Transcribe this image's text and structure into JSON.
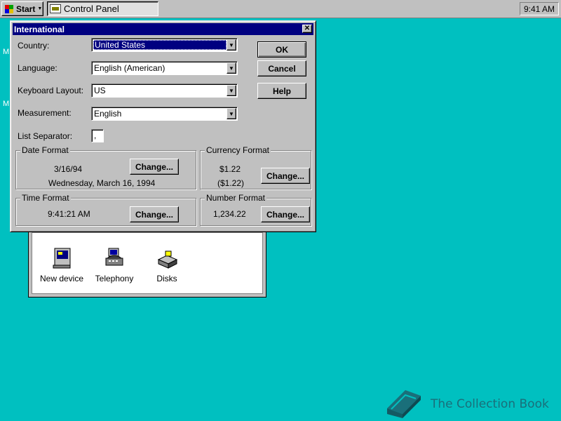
{
  "taskbar": {
    "start_label": "Start",
    "task_label": "Control Panel",
    "clock": "9:41 AM"
  },
  "desktop": {
    "edge_fragments": [
      "M",
      "M"
    ]
  },
  "control_panel": {
    "items": [
      {
        "label": "New device",
        "icon": "new-device-icon"
      },
      {
        "label": "Telephony",
        "icon": "telephony-icon"
      },
      {
        "label": "Disks",
        "icon": "disks-icon"
      }
    ]
  },
  "dialog": {
    "title": "International",
    "country": {
      "label": "Country:",
      "value": "United States"
    },
    "language": {
      "label": "Language:",
      "value": "English (American)"
    },
    "keyboard": {
      "label": "Keyboard Layout:",
      "value": "US"
    },
    "measurement": {
      "label": "Measurement:",
      "value": "English"
    },
    "list_separator": {
      "label": "List Separator:",
      "value": ","
    },
    "buttons": {
      "ok": "OK",
      "cancel": "Cancel",
      "help": "Help"
    },
    "date_format": {
      "title": "Date Format",
      "short": "3/16/94",
      "long": "Wednesday, March 16, 1994",
      "change": "Change..."
    },
    "currency_format": {
      "title": "Currency Format",
      "positive": "$1.22",
      "negative": "($1.22)",
      "change": "Change..."
    },
    "time_format": {
      "title": "Time Format",
      "value": "9:41:21 AM",
      "change": "Change..."
    },
    "number_format": {
      "title": "Number Format",
      "value": "1,234.22",
      "change": "Change..."
    }
  },
  "watermark": {
    "text": "The Collection Book"
  },
  "colors": {
    "desktop": "#00c0c0",
    "titlebar": "#000080",
    "face": "#c0c0c0",
    "watermark": "#1a6f7a"
  }
}
